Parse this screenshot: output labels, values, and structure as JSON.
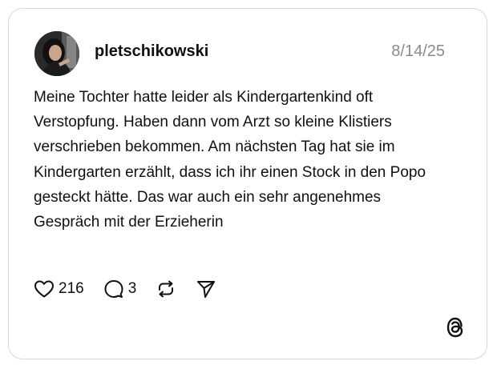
{
  "post": {
    "username": "pletschikowski",
    "date": "8/14/25",
    "text": "Meine Tochter hatte leider als Kindergartenkind oft Verstopfung. Haben dann vom Arzt so kleine Klistiers verschrieben bekommen. Am nächsten Tag hat sie im Kindergarten erzählt, dass ich ihr einen Stock in den Popo gesteckt hätte. Das war auch ein sehr angenehmes Gespräch mit der Erzieherin",
    "likes": "216",
    "replies": "3"
  },
  "icons": {
    "like": "heart-icon",
    "reply": "comment-bubble-icon",
    "repost": "repost-icon",
    "share": "send-icon",
    "brand": "threads-logo-icon"
  },
  "colors": {
    "card_border": "#d8d8d8",
    "date": "#8a8a8a",
    "text": "#101010"
  }
}
